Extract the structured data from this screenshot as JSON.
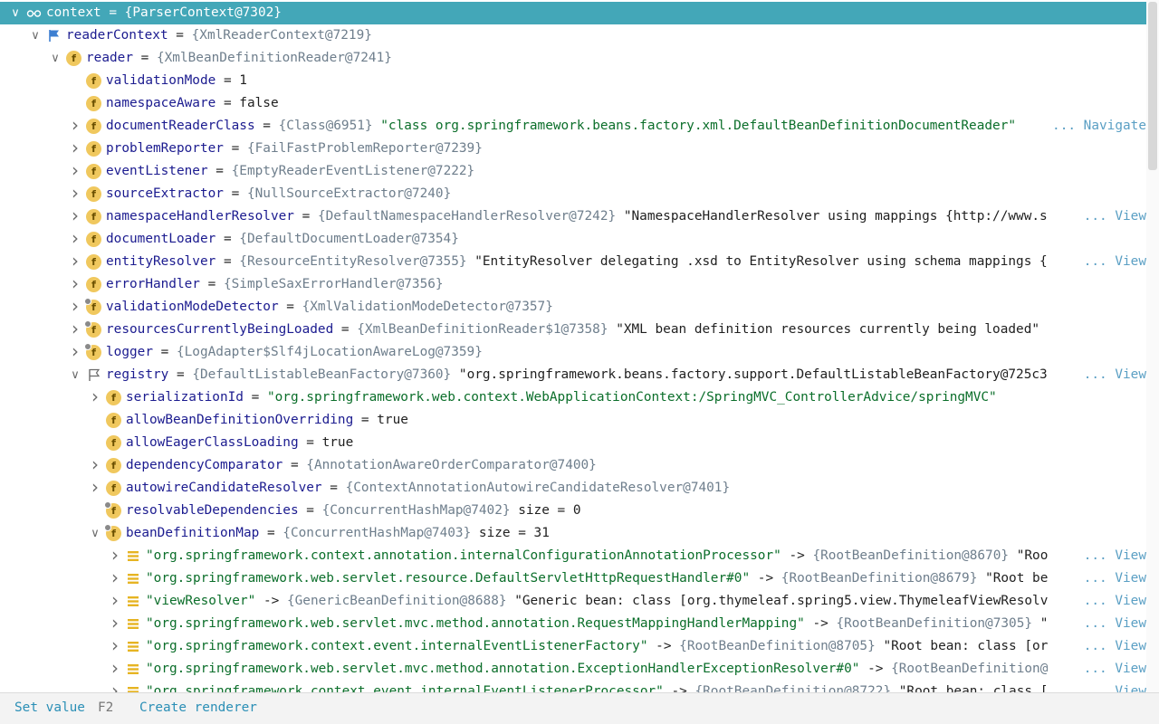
{
  "footer": {
    "set_value_label": "Set value",
    "set_value_shortcut": "F2",
    "create_renderer_label": "Create renderer"
  },
  "rows": [
    {
      "depth": 0,
      "arrow": "expanded",
      "icon": "glasses-icon",
      "selected": true,
      "name": "context",
      "op": " = ",
      "val": "{ParserContext@7302}",
      "extra": "",
      "extra_type": "",
      "link": ""
    },
    {
      "depth": 1,
      "arrow": "expanded",
      "icon": "flag-icon",
      "name": "readerContext",
      "op": " = ",
      "val": "{XmlReaderContext@7219}",
      "extra": "",
      "extra_type": "",
      "link": ""
    },
    {
      "depth": 2,
      "arrow": "expanded",
      "icon": "field-icon",
      "name": "reader",
      "op": " = ",
      "val": "{XmlBeanDefinitionReader@7241}",
      "extra": "",
      "extra_type": "",
      "link": ""
    },
    {
      "depth": 3,
      "arrow": "none",
      "icon": "field-icon",
      "name": "validationMode",
      "op": " = ",
      "val": "",
      "extra": "1",
      "extra_type": "plain",
      "link": ""
    },
    {
      "depth": 3,
      "arrow": "none",
      "icon": "field-icon",
      "name": "namespaceAware",
      "op": " = ",
      "val": "",
      "extra": "false",
      "extra_type": "plain",
      "link": ""
    },
    {
      "depth": 3,
      "arrow": "collapsed",
      "icon": "field-icon",
      "name": "documentReaderClass",
      "op": " = ",
      "val": "{Class@6951}",
      "extra": "\"class org.springframework.beans.factory.xml.DefaultBeanDefinitionDocumentReader\"",
      "extra_type": "string",
      "link": "... Navigate"
    },
    {
      "depth": 3,
      "arrow": "collapsed",
      "icon": "field-icon",
      "name": "problemReporter",
      "op": " = ",
      "val": "{FailFastProblemReporter@7239}",
      "extra": "",
      "extra_type": "",
      "link": ""
    },
    {
      "depth": 3,
      "arrow": "collapsed",
      "icon": "field-icon",
      "name": "eventListener",
      "op": " = ",
      "val": "{EmptyReaderEventListener@7222}",
      "extra": "",
      "extra_type": "",
      "link": ""
    },
    {
      "depth": 3,
      "arrow": "collapsed",
      "icon": "field-icon",
      "name": "sourceExtractor",
      "op": " = ",
      "val": "{NullSourceExtractor@7240}",
      "extra": "",
      "extra_type": "",
      "link": ""
    },
    {
      "depth": 3,
      "arrow": "collapsed",
      "icon": "field-icon",
      "name": "namespaceHandlerResolver",
      "op": " = ",
      "val": "{DefaultNamespaceHandlerResolver@7242}",
      "extra": "\"NamespaceHandlerResolver using mappings {http://www.s",
      "extra_type": "plain",
      "link": "... View"
    },
    {
      "depth": 3,
      "arrow": "collapsed",
      "icon": "field-icon",
      "name": "documentLoader",
      "op": " = ",
      "val": "{DefaultDocumentLoader@7354}",
      "extra": "",
      "extra_type": "",
      "link": ""
    },
    {
      "depth": 3,
      "arrow": "collapsed",
      "icon": "field-icon",
      "name": "entityResolver",
      "op": " = ",
      "val": "{ResourceEntityResolver@7355}",
      "extra": "\"EntityResolver delegating .xsd to EntityResolver using schema mappings {",
      "extra_type": "plain",
      "link": "... View"
    },
    {
      "depth": 3,
      "arrow": "collapsed",
      "icon": "field-icon",
      "name": "errorHandler",
      "op": " = ",
      "val": "{SimpleSaxErrorHandler@7356}",
      "extra": "",
      "extra_type": "",
      "link": ""
    },
    {
      "depth": 3,
      "arrow": "collapsed",
      "icon": "field-final-icon",
      "name": "validationModeDetector",
      "op": " = ",
      "val": "{XmlValidationModeDetector@7357}",
      "extra": "",
      "extra_type": "",
      "link": ""
    },
    {
      "depth": 3,
      "arrow": "collapsed",
      "icon": "field-final-icon",
      "name": "resourcesCurrentlyBeingLoaded",
      "op": " = ",
      "val": "{XmlBeanDefinitionReader$1@7358}",
      "extra": "\"XML bean definition resources currently being loaded\"",
      "extra_type": "plain",
      "link": ""
    },
    {
      "depth": 3,
      "arrow": "collapsed",
      "icon": "field-final-icon",
      "name": "logger",
      "op": " = ",
      "val": "{LogAdapter$Slf4jLocationAwareLog@7359}",
      "extra": "",
      "extra_type": "",
      "link": ""
    },
    {
      "depth": 3,
      "arrow": "expanded",
      "icon": "flag-outline-icon",
      "name": "registry",
      "op": " = ",
      "val": "{DefaultListableBeanFactory@7360}",
      "extra": "\"org.springframework.beans.factory.support.DefaultListableBeanFactory@725c3",
      "extra_type": "plain",
      "link": "... View"
    },
    {
      "depth": 4,
      "arrow": "collapsed",
      "icon": "field-icon",
      "name": "serializationId",
      "op": " = ",
      "val": "",
      "extra": "\"org.springframework.web.context.WebApplicationContext:/SpringMVC_ControllerAdvice/springMVC\"",
      "extra_type": "string",
      "link": ""
    },
    {
      "depth": 4,
      "arrow": "none",
      "icon": "field-icon",
      "name": "allowBeanDefinitionOverriding",
      "op": " = ",
      "val": "",
      "extra": "true",
      "extra_type": "plain",
      "link": ""
    },
    {
      "depth": 4,
      "arrow": "none",
      "icon": "field-icon",
      "name": "allowEagerClassLoading",
      "op": " = ",
      "val": "",
      "extra": "true",
      "extra_type": "plain",
      "link": ""
    },
    {
      "depth": 4,
      "arrow": "collapsed",
      "icon": "field-icon",
      "name": "dependencyComparator",
      "op": " = ",
      "val": "{AnnotationAwareOrderComparator@7400}",
      "extra": "",
      "extra_type": "",
      "link": ""
    },
    {
      "depth": 4,
      "arrow": "collapsed",
      "icon": "field-icon",
      "name": "autowireCandidateResolver",
      "op": " = ",
      "val": "{ContextAnnotationAutowireCandidateResolver@7401}",
      "extra": "",
      "extra_type": "",
      "link": ""
    },
    {
      "depth": 4,
      "arrow": "none",
      "icon": "field-final-icon",
      "name": "resolvableDependencies",
      "op": " = ",
      "val": "{ConcurrentHashMap@7402}",
      "extra": " size = 0",
      "extra_type": "plain",
      "link": ""
    },
    {
      "depth": 4,
      "arrow": "expanded",
      "icon": "field-final-icon",
      "name": "beanDefinitionMap",
      "op": " = ",
      "val": "{ConcurrentHashMap@7403}",
      "extra": " size = 31",
      "extra_type": "plain",
      "link": ""
    },
    {
      "depth": 5,
      "arrow": "collapsed",
      "icon": "list-icon",
      "key": "\"org.springframework.context.annotation.internalConfigurationAnnotationProcessor\"",
      "op": " -> ",
      "val": "{RootBeanDefinition@8670}",
      "extra": "\"Roo",
      "extra_type": "plain",
      "link": "... View"
    },
    {
      "depth": 5,
      "arrow": "collapsed",
      "icon": "list-icon",
      "key": "\"org.springframework.web.servlet.resource.DefaultServletHttpRequestHandler#0\"",
      "op": " -> ",
      "val": "{RootBeanDefinition@8679}",
      "extra": "\"Root be",
      "extra_type": "plain",
      "link": "... View"
    },
    {
      "depth": 5,
      "arrow": "collapsed",
      "icon": "list-icon",
      "key": "\"viewResolver\"",
      "op": " -> ",
      "val": "{GenericBeanDefinition@8688}",
      "extra": "\"Generic bean: class [org.thymeleaf.spring5.view.ThymeleafViewResolv",
      "extra_type": "plain",
      "link": "... View"
    },
    {
      "depth": 5,
      "arrow": "collapsed",
      "icon": "list-icon",
      "key": "\"org.springframework.web.servlet.mvc.method.annotation.RequestMappingHandlerMapping\"",
      "op": " -> ",
      "val": "{RootBeanDefinition@7305}",
      "extra": "\"",
      "extra_type": "plain",
      "link": "... View"
    },
    {
      "depth": 5,
      "arrow": "collapsed",
      "icon": "list-icon",
      "key": "\"org.springframework.context.event.internalEventListenerFactory\"",
      "op": " -> ",
      "val": "{RootBeanDefinition@8705}",
      "extra": "\"Root bean: class [or",
      "extra_type": "plain",
      "link": "... View"
    },
    {
      "depth": 5,
      "arrow": "collapsed",
      "icon": "list-icon",
      "key": "\"org.springframework.web.servlet.mvc.method.annotation.ExceptionHandlerExceptionResolver#0\"",
      "op": " -> ",
      "val": "{RootBeanDefinition@",
      "extra": "",
      "extra_type": "plain",
      "link": "... View"
    },
    {
      "depth": 5,
      "arrow": "collapsed",
      "icon": "list-icon",
      "key": "\"org.springframework.context.event.internalEventListenerProcessor\"",
      "op": " -> ",
      "val": "{RootBeanDefinition@8722}",
      "extra": "\"Root bean: class [",
      "extra_type": "plain",
      "link": "... View"
    }
  ]
}
